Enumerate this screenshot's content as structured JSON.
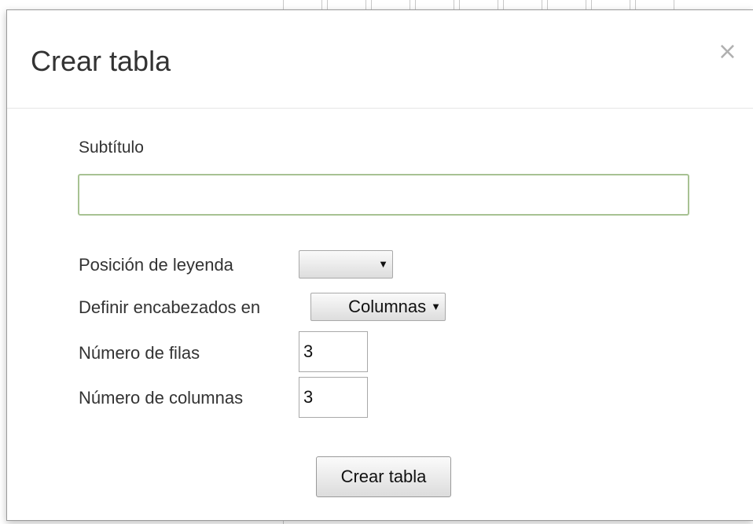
{
  "dialog": {
    "title": "Crear tabla",
    "close_symbol": "×"
  },
  "form": {
    "subtitle_label": "Subtítulo",
    "subtitle_value": "",
    "legend_position_label": "Posición de leyenda",
    "legend_position_value": "",
    "headers_label": "Definir encabezados en",
    "headers_value": "Columnas",
    "rows_label": "Número de filas",
    "rows_value": "3",
    "columns_label": "Número de columnas",
    "columns_value": "3",
    "submit_label": "Crear tabla",
    "dropdown_arrow": "▼"
  },
  "colors": {
    "input_focus_border": "#a8c293",
    "close_icon": "#b0b0b0"
  }
}
